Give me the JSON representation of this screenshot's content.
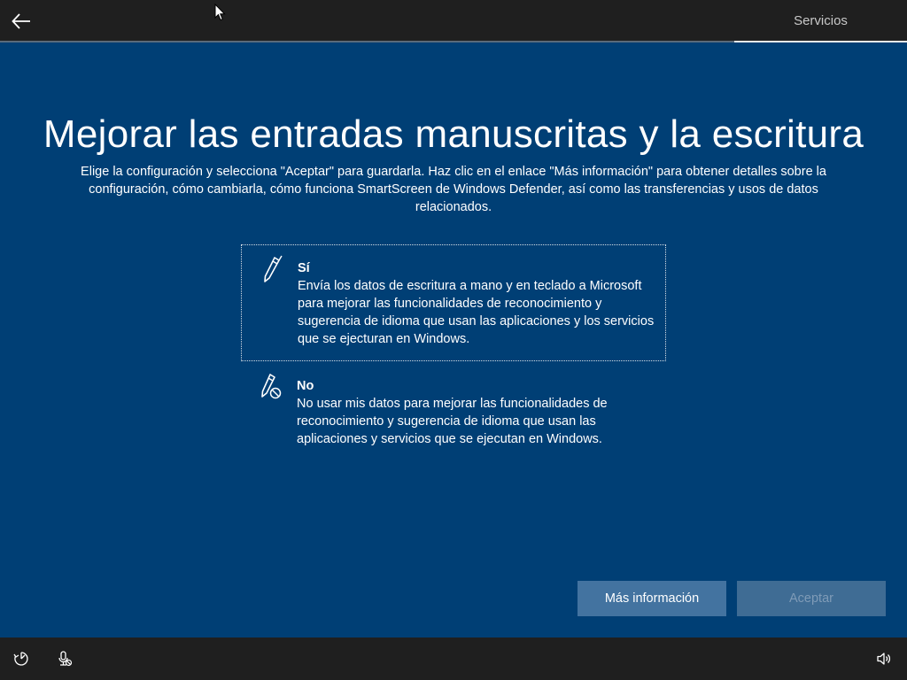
{
  "header": {
    "back_icon": "arrow-left-icon",
    "tab_label": "Servicios"
  },
  "main": {
    "title": "Mejorar las entradas manuscritas y la escritura",
    "description": "Elige la configuración y selecciona \"Aceptar\" para guardarla. Haz clic en el enlace \"Más información\" para obtener detalles sobre la configuración, cómo cambiarla, cómo funciona SmartScreen de Windows Defender, así como las transferencias y usos de datos relacionados.",
    "options": [
      {
        "title": "Sí",
        "body": "Envía los datos de escritura a mano y en teclado a Microsoft para mejorar las funcionalidades de reconocimiento y sugerencia de idioma que usan las aplicaciones y los servicios que se ejecturan en Windows.",
        "icon": "pen-icon",
        "selected": true
      },
      {
        "title": "No",
        "body": "No usar mis datos para mejorar las funcionalidades de reconocimiento y sugerencia de idioma que usan las aplicaciones y servicios que se ejecutan en Windows.",
        "icon": "pen-blocked-icon",
        "selected": false
      }
    ]
  },
  "buttons": {
    "more_info_label": "Más información",
    "accept_label": "Aceptar"
  },
  "bottombar": {
    "icons": [
      "ease-of-access-icon",
      "microphone-off-icon",
      "volume-icon"
    ]
  },
  "colors": {
    "background": "#003f75",
    "bar": "#1f1f1f",
    "button": "#4373a0",
    "button_disabled_text": "#7f9bb7"
  }
}
